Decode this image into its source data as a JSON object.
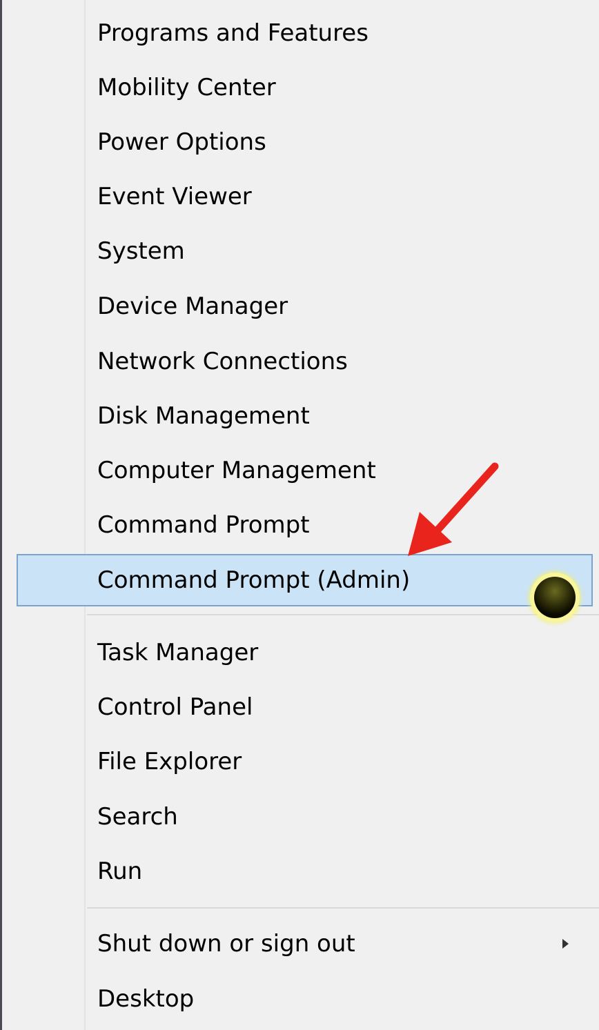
{
  "menu": {
    "items": [
      {
        "label": "Programs and Features"
      },
      {
        "label": "Mobility Center"
      },
      {
        "label": "Power Options"
      },
      {
        "label": "Event Viewer"
      },
      {
        "label": "System"
      },
      {
        "label": "Device Manager"
      },
      {
        "label": "Network Connections"
      },
      {
        "label": "Disk Management"
      },
      {
        "label": "Computer Management"
      },
      {
        "label": "Command Prompt"
      },
      {
        "label": "Command Prompt (Admin)",
        "highlighted": true
      },
      {
        "label": "Task Manager"
      },
      {
        "label": "Control Panel"
      },
      {
        "label": "File Explorer"
      },
      {
        "label": "Search"
      },
      {
        "label": "Run"
      },
      {
        "label": "Shut down or sign out",
        "has_submenu": true
      },
      {
        "label": "Desktop"
      }
    ]
  },
  "colors": {
    "highlight_background": "#cbe3f6",
    "highlight_border": "#7aa3cf",
    "menu_background": "#f0f0f0",
    "annotation_arrow": "#e8241c",
    "cursor_halo": "#f8f59a"
  },
  "icons": {
    "submenu": "triangle-right-icon",
    "annotation": "red-arrow-icon",
    "cursor": "cursor-highlight-dot"
  }
}
